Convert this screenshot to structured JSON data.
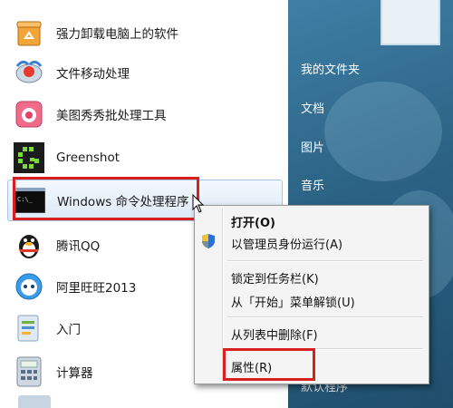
{
  "programs": [
    {
      "label": "强力卸载电脑上的软件",
      "icon": "recycle-box-icon"
    },
    {
      "label": "文件移动处理",
      "icon": "satellite-dish-icon"
    },
    {
      "label": "美图秀秀批处理工具",
      "icon": "camera-app-icon"
    },
    {
      "label": "Greenshot",
      "icon": "greenshot-icon"
    },
    {
      "label": "Windows 命令处理程序",
      "icon": "command-prompt-icon"
    },
    {
      "label": "腾讯QQ",
      "icon": "penguin-icon"
    },
    {
      "label": "阿里旺旺2013",
      "icon": "wangwang-icon"
    },
    {
      "label": "入门",
      "icon": "getting-started-icon"
    },
    {
      "label": "计算器",
      "icon": "calculator-icon"
    }
  ],
  "right_links": [
    {
      "label": "我的文件夹"
    },
    {
      "label": "文档"
    },
    {
      "label": "图片"
    },
    {
      "label": "音乐"
    },
    {
      "label": "默认程序"
    }
  ],
  "context_menu": [
    {
      "label": "打开(O)",
      "bold": true
    },
    {
      "label": "以管理员身份运行(A)",
      "icon": "uac-shield-icon"
    },
    {
      "label": "锁定到任务栏(K)"
    },
    {
      "label": "从「开始」菜单解锁(U)"
    },
    {
      "label": "从列表中删除(F)"
    },
    {
      "label": "属性(R)"
    }
  ],
  "colors": {
    "highlight_box": "#d8201e",
    "right_pane": "#2c6385"
  }
}
